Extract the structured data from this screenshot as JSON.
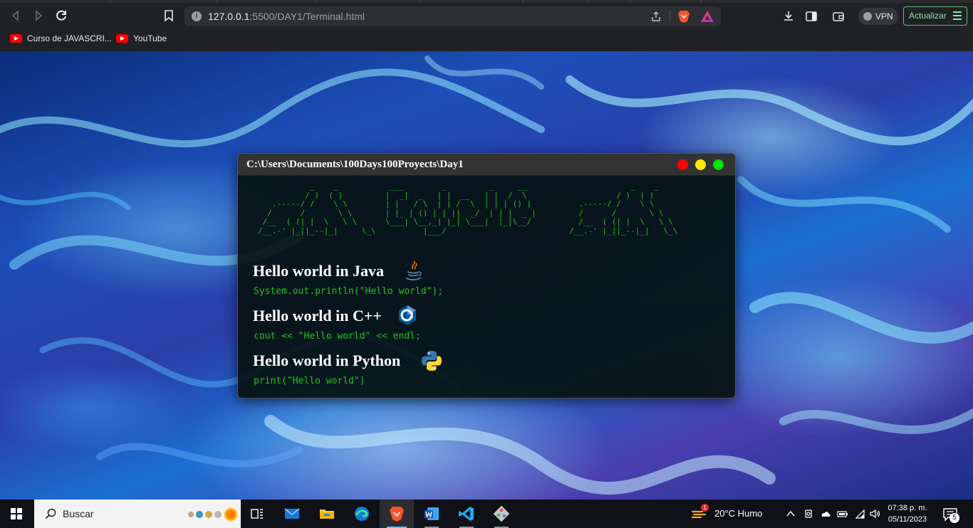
{
  "browser": {
    "url_host": "127.0.0.1",
    "url_path": ":5500/DAY1/Terminal.html",
    "vpn_label": "VPN",
    "update_label": "Actualizar",
    "bookmarks": [
      {
        "label": "Curso de JAVASCRI..."
      },
      {
        "label": "YouTube"
      }
    ]
  },
  "terminal": {
    "title": "C:\\Users\\Documents\\100Days100Proyects\\Day1",
    "ascii_art": "           _    _           ___        _         _     __                      _    _  \n          / )  ( )         |  _|  _   | |  __   | |  /  \\                   / )  ( ) \n   .-----/ /    \\ \\        | |   / \\  | | /  \\  | | | () |          .-----/ /    \\ \\ \n  /      /       \\ \\       | |_ | () | | ||  _/  | | |  _ |         /      /       \\ \\ \n /__  ( (| |  \\   \\ \\      \\___| \\__,_| |_| \\___|  |_|\\__/          /__  ( (| |  \\   \\ \\\n/__.-' |_||_--|_|     \\_\\          |___/                          /__.-' |_||_--|_|   \\_\\",
    "sections": [
      {
        "heading": "Hello world in Java",
        "code": "System.out.println(\"Hello world\");"
      },
      {
        "heading": "Hello world in C++",
        "code": "cout << \"Hello world\" << endl;"
      },
      {
        "heading": "Hello world in Python",
        "code": "print(\"Hello world\")"
      }
    ]
  },
  "taskbar": {
    "search_placeholder": "Buscar",
    "weather_badge": "1",
    "weather_text": "20°C  Humo",
    "time": "07:38 p. m.",
    "date": "05/11/2023",
    "notification_count": "5"
  },
  "colors": {
    "terminal_green": "#22c322",
    "update_green": "#8ee39f"
  }
}
